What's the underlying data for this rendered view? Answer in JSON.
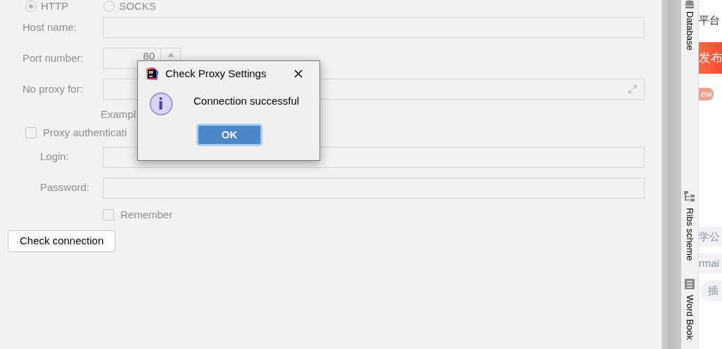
{
  "proxy_type": [
    {
      "label": "HTTP",
      "selected": true
    },
    {
      "label": "SOCKS",
      "selected": false
    }
  ],
  "fields": [
    {
      "label": "Host name:",
      "kind": "text"
    },
    {
      "label": "Port number:",
      "kind": "spinner",
      "value": "80"
    },
    {
      "label": "No proxy for:",
      "kind": "expandable"
    }
  ],
  "example_hint": "Exampl",
  "proxy_auth": {
    "label": "Proxy authenticati",
    "checked": false
  },
  "auth_fields": [
    {
      "label": "Login:"
    },
    {
      "label": "Password:"
    }
  ],
  "remember": {
    "label": "Remember",
    "checked": false
  },
  "check_button": "Check connection",
  "dialog": {
    "title": "Check Proxy Settings",
    "message": "Connection successful",
    "ok_button": "OK"
  },
  "tool_windows": [
    {
      "label": "Database",
      "kind": "database"
    },
    {
      "label": "Ribs scheme",
      "kind": "scheme"
    },
    {
      "label": "Word Book",
      "kind": "book"
    }
  ],
  "background_page": [
    {
      "text": "平台",
      "kind": "text"
    },
    {
      "text": "发布",
      "kind": "button"
    },
    {
      "text": "ew",
      "kind": "badge"
    },
    {
      "text": "学公",
      "kind": "chip"
    },
    {
      "text": "rmai",
      "kind": "chip"
    },
    {
      "text": "插",
      "kind": "pill"
    }
  ]
}
